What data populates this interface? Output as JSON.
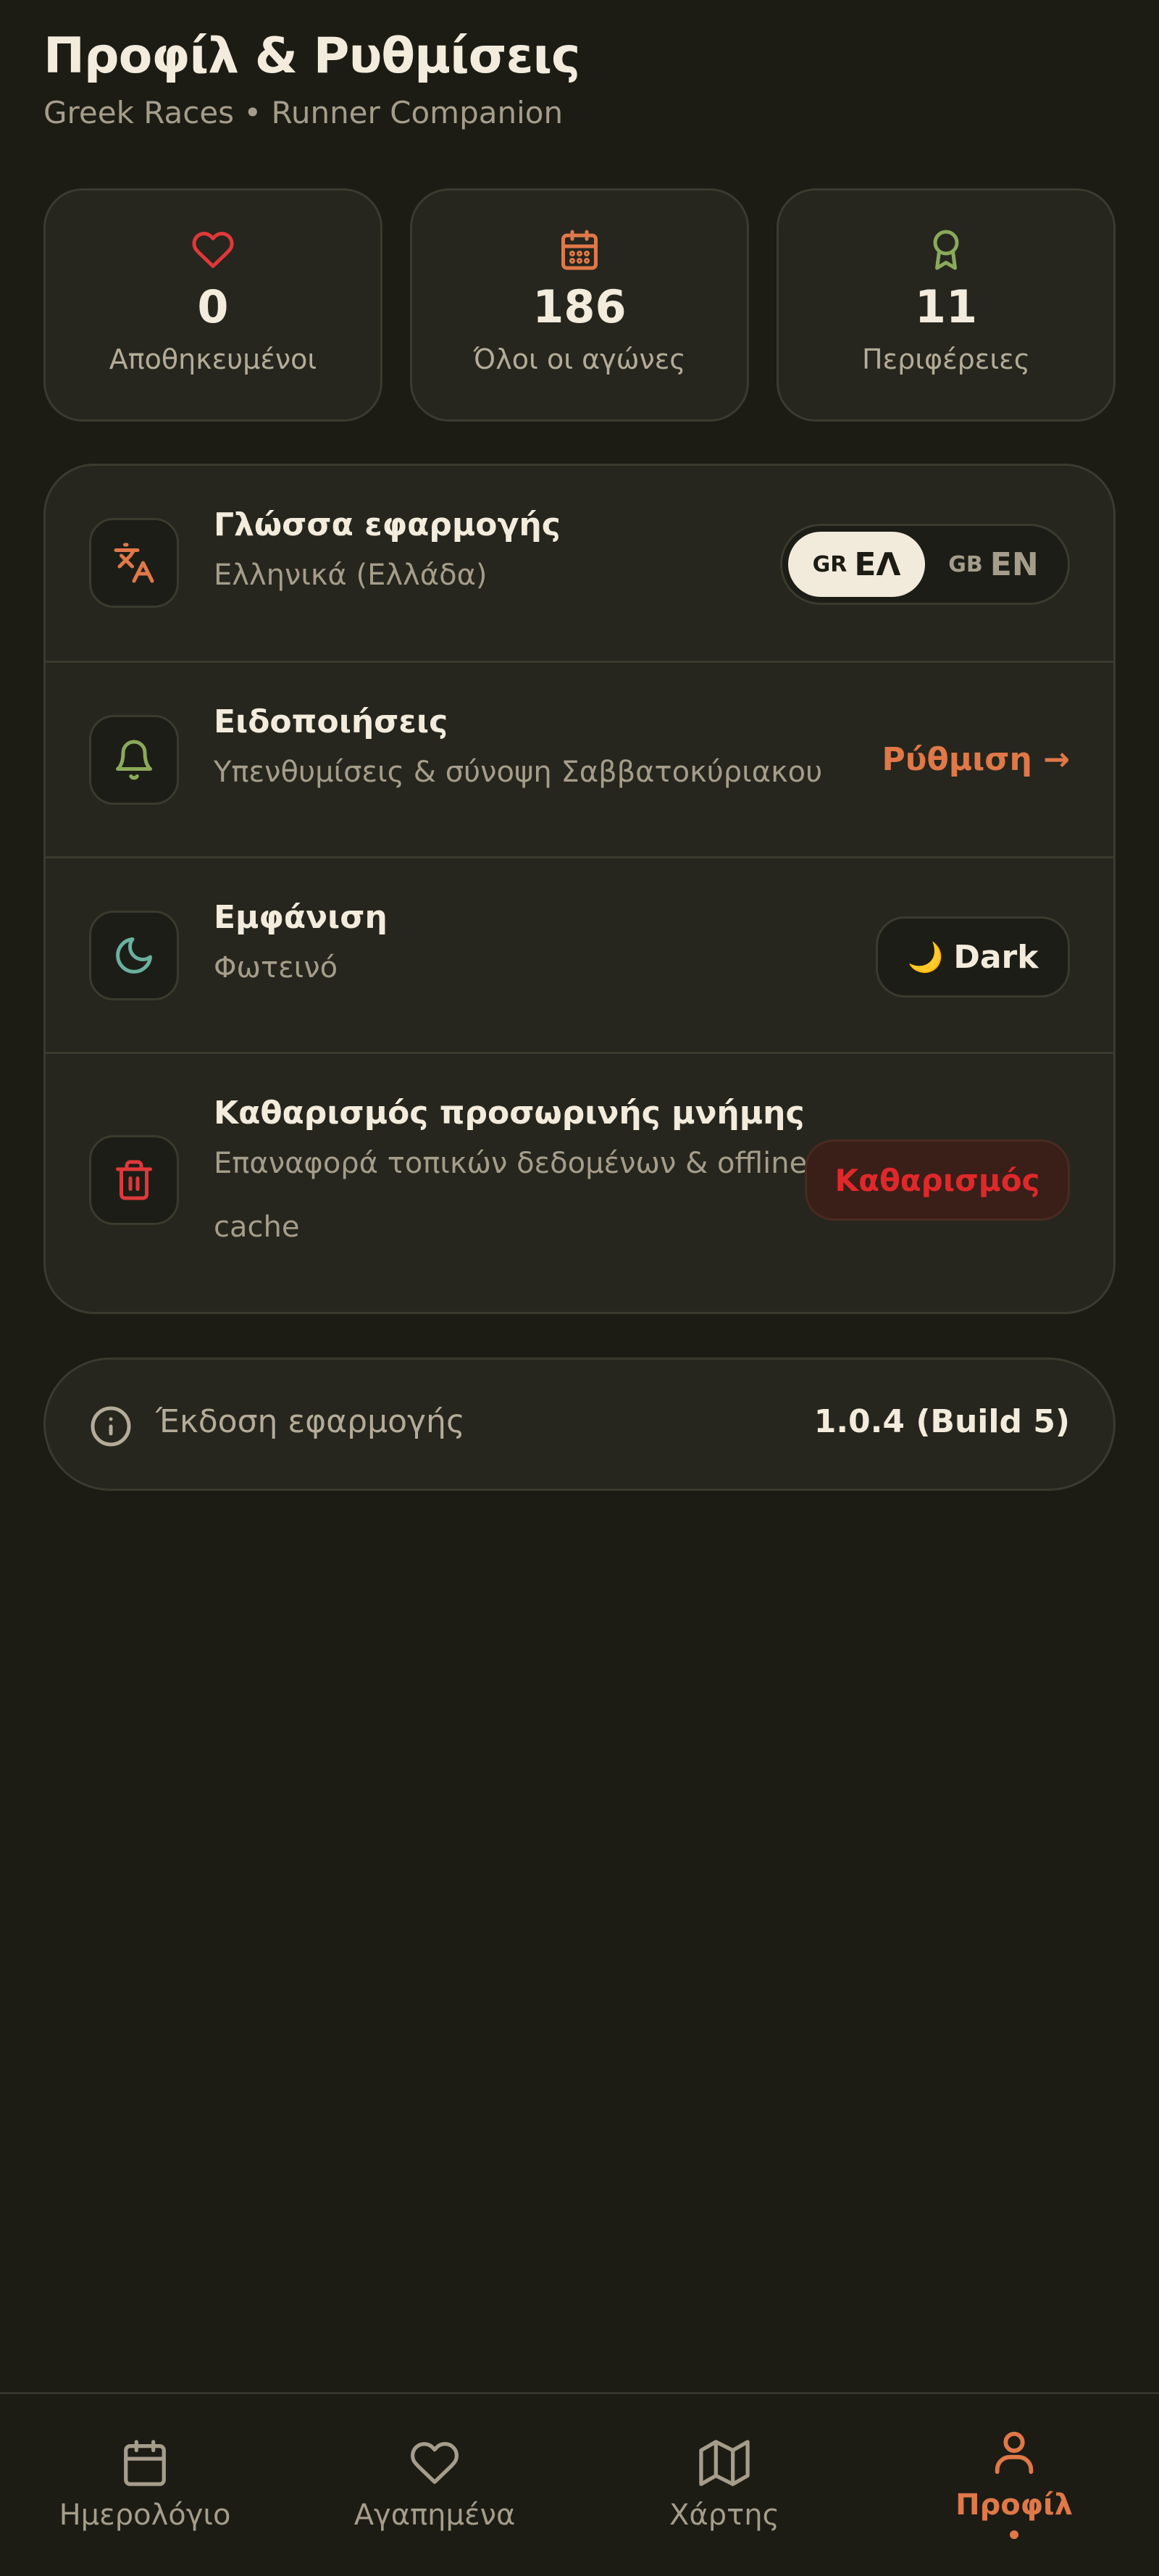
{
  "header": {
    "title": "Προφίλ & Ρυθμίσεις",
    "subtitle": "Greek Races • Runner Companion"
  },
  "stats": [
    {
      "icon": "heart-icon",
      "value": "0",
      "label": "Αποθηκευμένοι",
      "color": "#e0383a"
    },
    {
      "icon": "calendar-icon",
      "value": "186",
      "label": "Όλοι οι αγώνες",
      "color": "#e07848"
    },
    {
      "icon": "award-icon",
      "value": "11",
      "label": "Περιφέρειες",
      "color": "#8aaa5a"
    }
  ],
  "settings": {
    "language": {
      "title": "Γλώσσα εφαρμογής",
      "subtitle": "Ελληνικά (Ελλάδα)",
      "options": [
        {
          "flag": "GR",
          "label": "ΕΛ",
          "active": true
        },
        {
          "flag": "GB",
          "label": "EN",
          "active": false
        }
      ]
    },
    "notifications": {
      "title": "Ειδοποιήσεις",
      "subtitle": "Υπενθυμίσεις & σύνοψη Σαββατοκύριακου",
      "action": "Ρύθμιση →"
    },
    "appearance": {
      "title": "Εμφάνιση",
      "subtitle": "Φωτεινό",
      "moon": "🌙",
      "action": "Dark"
    },
    "cache": {
      "title": "Καθαρισμός προσωρινής μνήμης",
      "subtitle_line1": "Επαναφορά τοπικών δεδομένων & offline",
      "subtitle_line2": "cache",
      "action": "Καθαρισμός"
    }
  },
  "version": {
    "label": "Έκδοση εφαρμογής",
    "value": "1.0.4 (Build 5)"
  },
  "tabs": [
    {
      "icon": "calendar-icon",
      "label": "Ημερολόγιο",
      "active": false
    },
    {
      "icon": "heart-icon",
      "label": "Αγαπημένα",
      "active": false
    },
    {
      "icon": "map-icon",
      "label": "Χάρτης",
      "active": false
    },
    {
      "icon": "user-icon",
      "label": "Προφίλ",
      "active": true
    }
  ],
  "colors": {
    "accent": "#e07848",
    "danger": "#e0282a",
    "background": "#1c1c15",
    "card": "#26261e"
  }
}
